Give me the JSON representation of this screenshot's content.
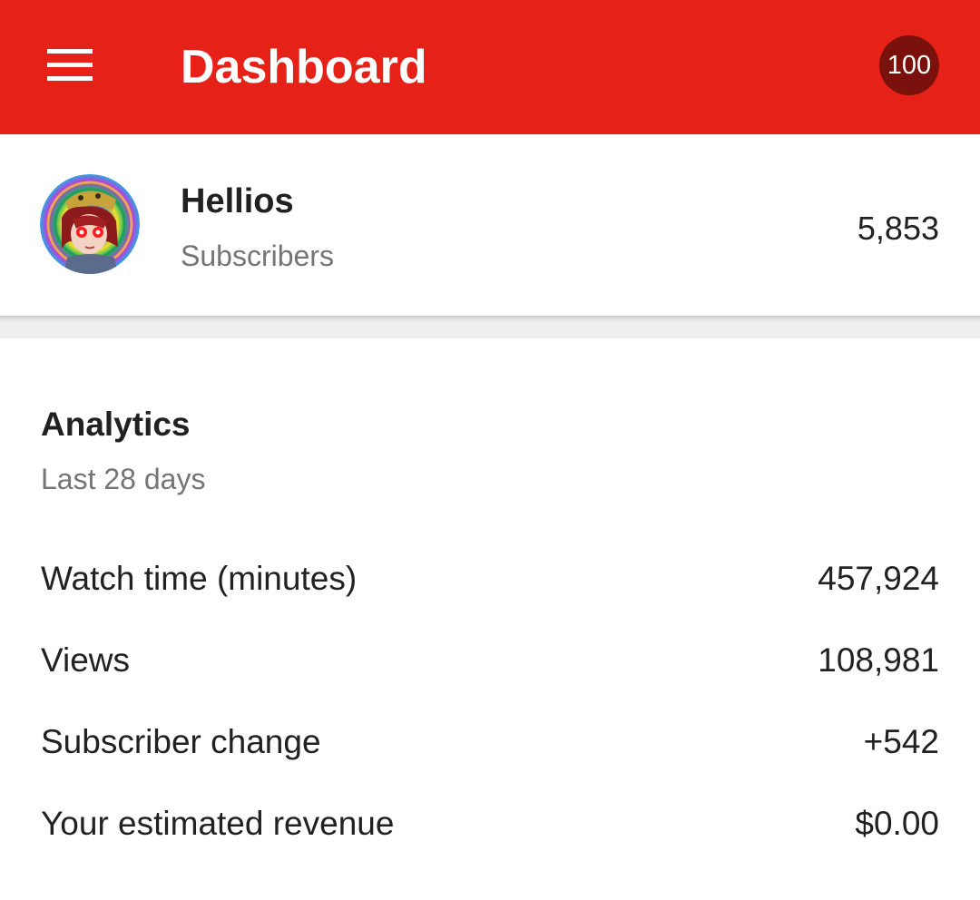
{
  "appbar": {
    "title": "Dashboard",
    "notification_count": "100",
    "menu_icon": "hamburger-menu-icon",
    "color": "#e62117",
    "badge_color": "#7a110c"
  },
  "channel": {
    "name": "Hellios",
    "subscribers_label": "Subscribers",
    "subscribers_count": "5,853"
  },
  "analytics": {
    "title": "Analytics",
    "period": "Last 28 days",
    "metrics": [
      {
        "label": "Watch time (minutes)",
        "value": "457,924"
      },
      {
        "label": "Views",
        "value": "108,981"
      },
      {
        "label": "Subscriber change",
        "value": "+542"
      },
      {
        "label": "Your estimated revenue",
        "value": "$0.00"
      }
    ]
  }
}
